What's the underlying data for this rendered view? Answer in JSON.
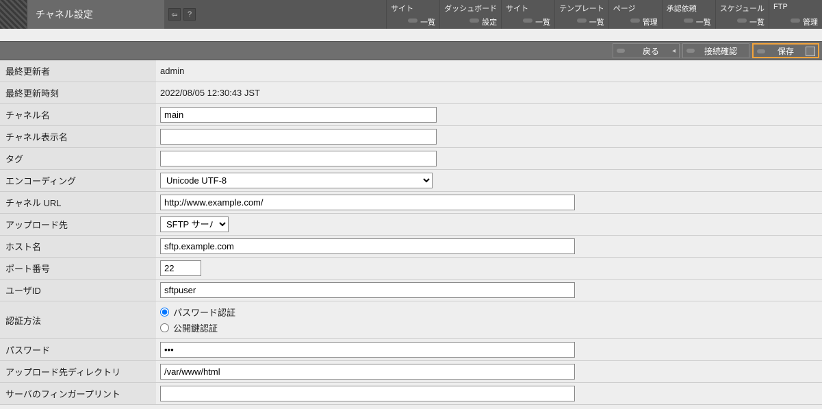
{
  "header": {
    "title": "チャネル設定",
    "nav": [
      {
        "label": "サイト",
        "sublabel": "一覧"
      },
      {
        "label": "ダッシュボード",
        "sublabel": "設定"
      },
      {
        "label": "サイト",
        "sublabel": "一覧"
      },
      {
        "label": "テンプレート",
        "sublabel": "一覧"
      },
      {
        "label": "ページ",
        "sublabel": "管理"
      },
      {
        "label": "承認依頼",
        "sublabel": "一覧"
      },
      {
        "label": "スケジュール",
        "sublabel": "一覧"
      },
      {
        "label": "FTP",
        "sublabel": "管理"
      }
    ]
  },
  "toolbar": {
    "back": "戻る",
    "connect": "接続確認",
    "save": "保存"
  },
  "labels": {
    "last_updater": "最終更新者",
    "last_updated": "最終更新時刻",
    "channel_name": "チャネル名",
    "channel_display": "チャネル表示名",
    "tag": "タグ",
    "encoding": "エンコーディング",
    "channel_url": "チャネル URL",
    "upload_dest": "アップロード先",
    "host": "ホスト名",
    "port": "ポート番号",
    "user_id": "ユーザID",
    "auth_method": "認証方法",
    "password": "パスワード",
    "upload_dir": "アップロード先ディレクトリ",
    "fingerprint": "サーバのフィンガープリント"
  },
  "values": {
    "last_updater": "admin",
    "last_updated": "2022/08/05 12:30:43 JST",
    "channel_name": "main",
    "channel_display": "",
    "tag": "",
    "encoding": "Unicode UTF-8",
    "channel_url": "http://www.example.com/",
    "upload_dest": "SFTP サーバ",
    "host": "sftp.example.com",
    "port": "22",
    "user_id": "sftpuser",
    "auth_password_label": "パスワード認証",
    "auth_pubkey_label": "公開鍵認証",
    "auth_selected": "password",
    "password": "•••",
    "upload_dir": "/var/www/html",
    "fingerprint": ""
  }
}
